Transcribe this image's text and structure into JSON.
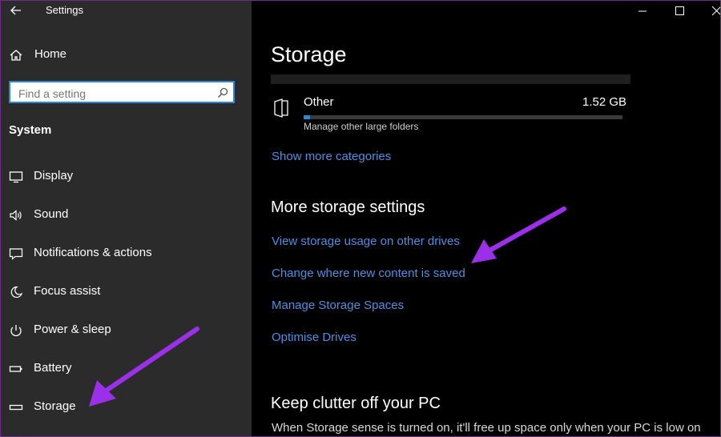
{
  "window": {
    "title": "Settings"
  },
  "sidebar": {
    "home_label": "Home",
    "search": {
      "placeholder": "Find a setting",
      "value": ""
    },
    "section_title": "System",
    "items": [
      {
        "label": "Display",
        "icon": "display-icon"
      },
      {
        "label": "Sound",
        "icon": "sound-icon"
      },
      {
        "label": "Notifications & actions",
        "icon": "notifications-icon"
      },
      {
        "label": "Focus assist",
        "icon": "focus-assist-icon"
      },
      {
        "label": "Power & sleep",
        "icon": "power-icon"
      },
      {
        "label": "Battery",
        "icon": "battery-icon"
      },
      {
        "label": "Storage",
        "icon": "storage-icon"
      }
    ]
  },
  "main": {
    "title": "Storage",
    "category": {
      "name": "Other",
      "size": "1.52 GB",
      "description": "Manage other large folders",
      "usage_fraction": 0.02
    },
    "show_more_link": "Show more categories",
    "more_settings": {
      "heading": "More storage settings",
      "links": [
        "View storage usage on other drives",
        "Change where new content is saved",
        "Manage Storage Spaces",
        "Optimise Drives"
      ]
    },
    "clutter": {
      "heading": "Keep clutter off your PC",
      "text": "When Storage sense is turned on, it'll free up space only when your PC is low on"
    }
  },
  "colors": {
    "accent": "#2e86d6",
    "link": "#4f8fe0",
    "annotation_arrow": "#9b30e8"
  }
}
